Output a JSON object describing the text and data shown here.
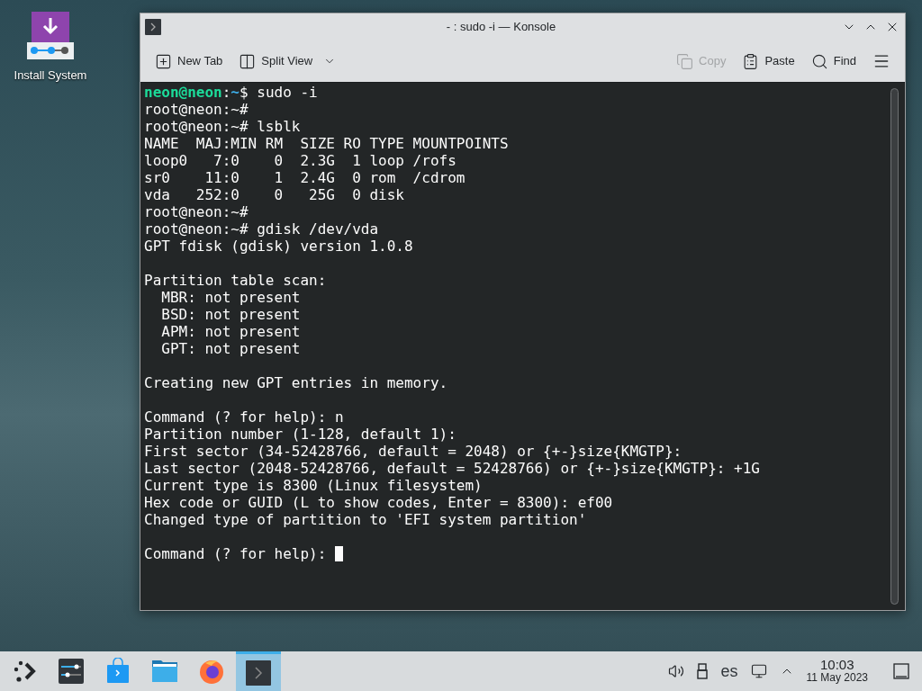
{
  "desktop_icons": [
    {
      "label": "Install System"
    }
  ],
  "window": {
    "title": "- : sudo -i — Konsole"
  },
  "toolbar": [
    {
      "kind": "new_tab",
      "label": "New Tab",
      "disabled": false
    },
    {
      "kind": "split_view",
      "label": "Split View",
      "disabled": false
    },
    {
      "kind": "copy",
      "label": "Copy",
      "disabled": true
    },
    {
      "kind": "paste",
      "label": "Paste",
      "disabled": false
    },
    {
      "kind": "find",
      "label": "Find",
      "disabled": false
    }
  ],
  "terminal": {
    "lines": [
      {
        "kind": "user_prompt",
        "user": "neon@neon",
        "sep": ":",
        "path": "~",
        "rest": "$ sudo -i"
      },
      {
        "kind": "text",
        "text": "root@neon:~#"
      },
      {
        "kind": "text",
        "text": "root@neon:~# lsblk"
      },
      {
        "kind": "text",
        "text": "NAME  MAJ:MIN RM  SIZE RO TYPE MOUNTPOINTS"
      },
      {
        "kind": "text",
        "text": "loop0   7:0    0  2.3G  1 loop /rofs"
      },
      {
        "kind": "text",
        "text": "sr0    11:0    1  2.4G  0 rom  /cdrom"
      },
      {
        "kind": "text",
        "text": "vda   252:0    0   25G  0 disk"
      },
      {
        "kind": "text",
        "text": "root@neon:~#"
      },
      {
        "kind": "text",
        "text": "root@neon:~# gdisk /dev/vda"
      },
      {
        "kind": "text",
        "text": "GPT fdisk (gdisk) version 1.0.8"
      },
      {
        "kind": "blank"
      },
      {
        "kind": "text",
        "text": "Partition table scan:"
      },
      {
        "kind": "text",
        "text": "  MBR: not present"
      },
      {
        "kind": "text",
        "text": "  BSD: not present"
      },
      {
        "kind": "text",
        "text": "  APM: not present"
      },
      {
        "kind": "text",
        "text": "  GPT: not present"
      },
      {
        "kind": "blank"
      },
      {
        "kind": "text",
        "text": "Creating new GPT entries in memory."
      },
      {
        "kind": "blank"
      },
      {
        "kind": "text",
        "text": "Command (? for help): n"
      },
      {
        "kind": "text",
        "text": "Partition number (1-128, default 1):"
      },
      {
        "kind": "text",
        "text": "First sector (34-52428766, default = 2048) or {+-}size{KMGTP}:"
      },
      {
        "kind": "text",
        "text": "Last sector (2048-52428766, default = 52428766) or {+-}size{KMGTP}: +1G"
      },
      {
        "kind": "text",
        "text": "Current type is 8300 (Linux filesystem)"
      },
      {
        "kind": "text",
        "text": "Hex code or GUID (L to show codes, Enter = 8300): ef00"
      },
      {
        "kind": "text",
        "text": "Changed type of partition to 'EFI system partition'"
      },
      {
        "kind": "blank"
      },
      {
        "kind": "input",
        "text": "Command (? for help):",
        "cursor": true
      }
    ]
  },
  "taskbar": {
    "items": [
      {
        "kind": "launcher",
        "selected": false
      },
      {
        "kind": "settings",
        "selected": false
      },
      {
        "kind": "store",
        "selected": false
      },
      {
        "kind": "files",
        "selected": false
      },
      {
        "kind": "browser",
        "selected": false
      },
      {
        "kind": "terminal",
        "selected": true
      }
    ],
    "keyboard_layout": "es",
    "time": "10:03",
    "date": "11 May 2023"
  }
}
